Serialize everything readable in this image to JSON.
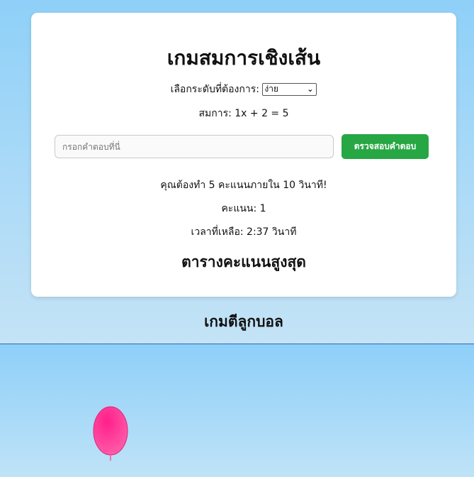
{
  "card": {
    "title": "เกมสมการเชิงเส้น",
    "level_label": "เลือกระดับที่ต้องการ:",
    "level_selected": "ง่าย",
    "equation": "สมการ: 1x + 2 = 5",
    "answer_placeholder": "กรอกคำตอบที่นี่",
    "check_button": "ตรวจสอบคำตอบ",
    "goal": "คุณต้องทำ 5 คะแนนภายใน 10 วินาที!",
    "score": "คะแนน: 1",
    "time_left": "เวลาที่เหลือ: 2:37 วินาที",
    "leaderboard_title": "ตารางคะแนนสูงสุด"
  },
  "ball_game": {
    "title": "เกมตีลูกบอล",
    "balloon_color": "#ff3d97"
  }
}
